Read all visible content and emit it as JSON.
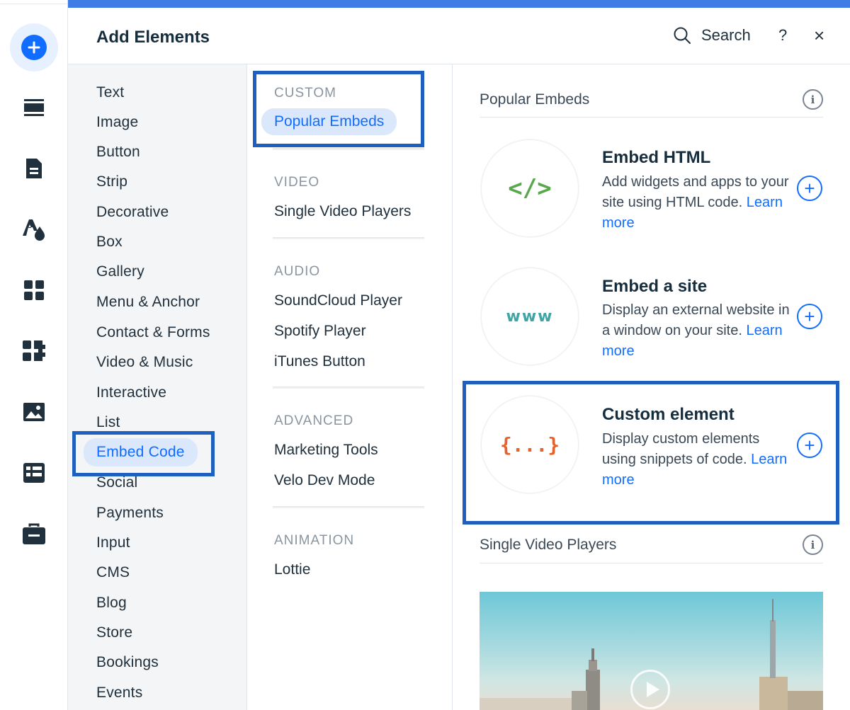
{
  "header": {
    "title": "Add Elements",
    "search_label": "Search",
    "help_label": "?",
    "close_label": "×"
  },
  "rail": {
    "icons": [
      "add-elements-icon",
      "sections-icon",
      "pages-icon",
      "design-icon",
      "apps-icon",
      "business-apps-icon",
      "media-icon",
      "cms-icon",
      "portfolio-icon"
    ]
  },
  "categories": [
    "Text",
    "Image",
    "Button",
    "Strip",
    "Decorative",
    "Box",
    "Gallery",
    "Menu & Anchor",
    "Contact & Forms",
    "Video & Music",
    "Interactive",
    "List",
    "Embed Code",
    "Social",
    "Payments",
    "Input",
    "CMS",
    "Blog",
    "Store",
    "Bookings",
    "Events"
  ],
  "selected_category": "Embed Code",
  "subs": {
    "custom_header": "CUSTOM",
    "popular_embeds": "Popular Embeds",
    "video_header": "VIDEO",
    "single_video_players": "Single Video Players",
    "audio_header": "AUDIO",
    "soundcloud": "SoundCloud Player",
    "spotify": "Spotify Player",
    "itunes": "iTunes Button",
    "advanced_header": "ADVANCED",
    "marketing_tools": "Marketing Tools",
    "velo": "Velo Dev Mode",
    "animation_header": "ANIMATION",
    "lottie": "Lottie"
  },
  "content": {
    "popular_title": "Popular Embeds",
    "cards": [
      {
        "title": "Embed HTML",
        "desc": "Add widgets and apps to your site using HTML code.",
        "link": "Learn more",
        "glyph": "</>"
      },
      {
        "title": "Embed a site",
        "desc": "Display an external website in a window on your site.",
        "link": "Learn more",
        "glyph": "www"
      },
      {
        "title": "Custom element",
        "desc": "Display custom elements using snippets of code.",
        "link": "Learn more",
        "glyph": "{...}"
      }
    ],
    "video_title": "Single Video Players",
    "info_glyph": "i",
    "plus_glyph": "+"
  },
  "colors": {
    "accent": "#116dff",
    "highlight_box": "#1f5fbf",
    "topbar": "#3e7ce6",
    "html_icon": "#5aa84c",
    "www_icon": "#3fa4a4",
    "custom_icon": "#e5622b"
  }
}
